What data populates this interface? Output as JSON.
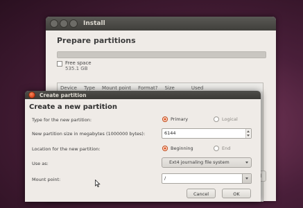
{
  "install": {
    "title": "Install",
    "heading": "Prepare partitions",
    "free_space_label": "Free space",
    "free_space_size": "535.1 GB",
    "table_columns": [
      "Device",
      "Type",
      "Mount point",
      "Format?",
      "Size",
      "Used"
    ]
  },
  "dialog": {
    "title": "Create partition",
    "heading": "Create a new partition",
    "type_label": "Type for the new partition:",
    "type_primary": "Primary",
    "type_logical": "Logical",
    "type_selected": "Primary",
    "size_label": "New partition size in megabytes (1000000 bytes):",
    "size_value": "6144",
    "location_label": "Location for the new partition:",
    "location_beginning": "Beginning",
    "location_end": "End",
    "location_selected": "Beginning",
    "use_as_label": "Use as:",
    "use_as_value": "Ext4 journaling file system",
    "mount_point_label": "Mount point:",
    "mount_point_value": "/",
    "cancel_label": "Cancel",
    "ok_label": "OK"
  },
  "colors": {
    "accent": "#e2541f",
    "window_bg": "#efebe7",
    "titlebar": "#403f3b"
  }
}
